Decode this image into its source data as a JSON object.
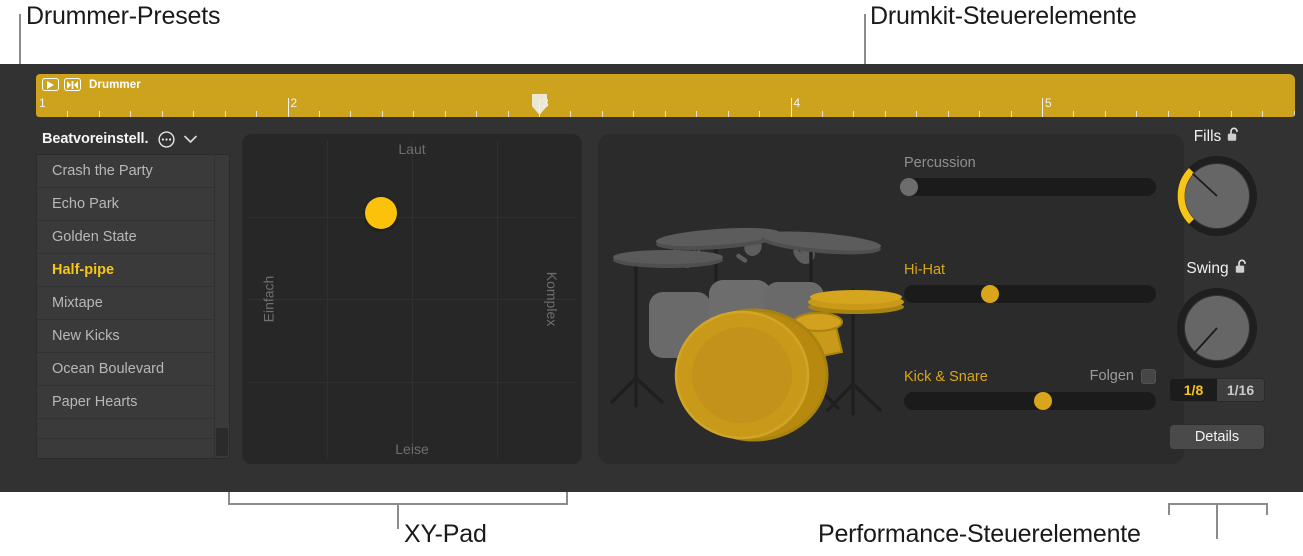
{
  "annotations": {
    "presets": "Drummer-Presets",
    "drumkit": "Drumkit-Steuerelemente",
    "xypad": "XY-Pad",
    "performance": "Performance-Steuerelemente"
  },
  "region": {
    "name": "Drummer",
    "play_icon": "play-icon",
    "loop_icon": "cycle-icon",
    "bars": [
      "1",
      "2",
      "3",
      "4",
      "5"
    ],
    "playhead_bar": "3",
    "color": "#cda31d"
  },
  "presets": {
    "header": "Beatvoreinstell.",
    "more_icon": "ellipsis-circle-icon",
    "chevron_icon": "chevron-down-icon",
    "selected": "Half-pipe",
    "items": [
      "Crash the Party",
      "Echo Park",
      "Golden State",
      "Half-pipe",
      "Mixtape",
      "New Kicks",
      "Ocean Boulevard",
      "Paper Hearts"
    ]
  },
  "xy_pad": {
    "top_label": "Laut",
    "bottom_label": "Leise",
    "left_label": "Einfach",
    "right_label": "Komplex",
    "puck_x_pct": 41,
    "puck_y_pct": 24,
    "puck_color": "#fcc20b"
  },
  "kit": {
    "percussion_icons": [
      "tambourine-icon",
      "shaker-icon",
      "clap-icon"
    ],
    "highlight_color": "#c9991a",
    "sliders": [
      {
        "label": "Percussion",
        "value_pct": 2,
        "active": false,
        "knob": "grey"
      },
      {
        "label": "Hi-Hat",
        "value_pct": 34,
        "active": true,
        "knob": "gold"
      },
      {
        "label": "Kick & Snare",
        "value_pct": 55,
        "active": true,
        "knob": "gold"
      }
    ],
    "follow": {
      "label": "Folgen",
      "checked": false
    }
  },
  "performance": {
    "fills": {
      "label": "Fills",
      "lock_icon": "unlocked-icon",
      "value_pct": 18,
      "arc": true
    },
    "swing": {
      "label": "Swing",
      "lock_icon": "unlocked-icon",
      "value_pct": 8,
      "arc": false
    },
    "segments": [
      {
        "label": "1/8",
        "selected": true
      },
      {
        "label": "1/16",
        "selected": false
      }
    ],
    "details_button": "Details"
  },
  "colors": {
    "accent": "#f5c518",
    "region": "#cda31d",
    "panel": "#2b2b2b",
    "window": "#323232"
  }
}
